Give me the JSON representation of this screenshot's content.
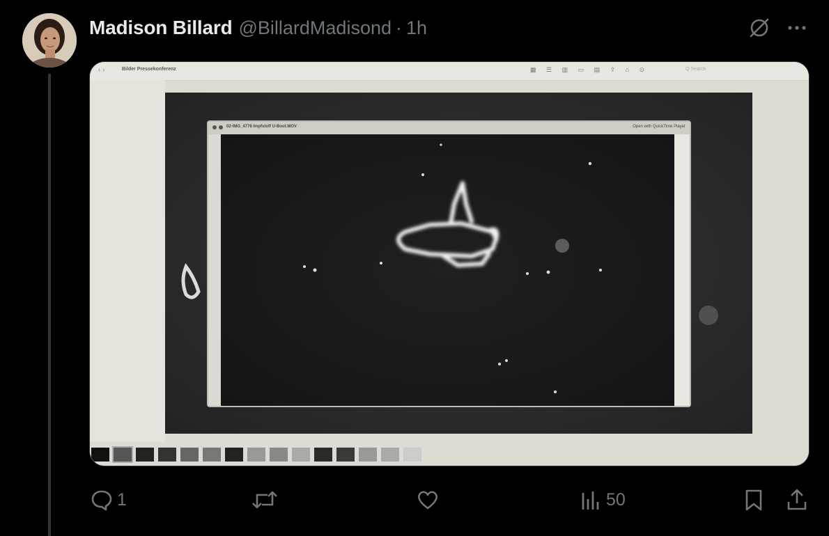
{
  "post": {
    "author_name": "Madison Billard",
    "handle": "@BillardMadisond",
    "separator": "·",
    "time": "1h",
    "header_icons": [
      "grok-icon",
      "more-icon"
    ]
  },
  "media": {
    "finder_title": "Bilder Pressekonferenz",
    "finder_nav": "‹  ›",
    "finder_toolbar": "▦ ☰ ▥ ▭  ▤ ⇪ ⌂ ⊙",
    "finder_search": "Q Search",
    "quicklook_title": "02-IMG_4778 Impfstoff U-Boot.MOV",
    "quicklook_open": "Open with QuickTime Player"
  },
  "actions": {
    "replies": "1",
    "reposts": "",
    "likes": "",
    "views": "50"
  },
  "colors": {
    "background": "#000000",
    "text_primary": "#e7e9ea",
    "text_secondary": "#71767b",
    "thread_line": "#333639"
  }
}
